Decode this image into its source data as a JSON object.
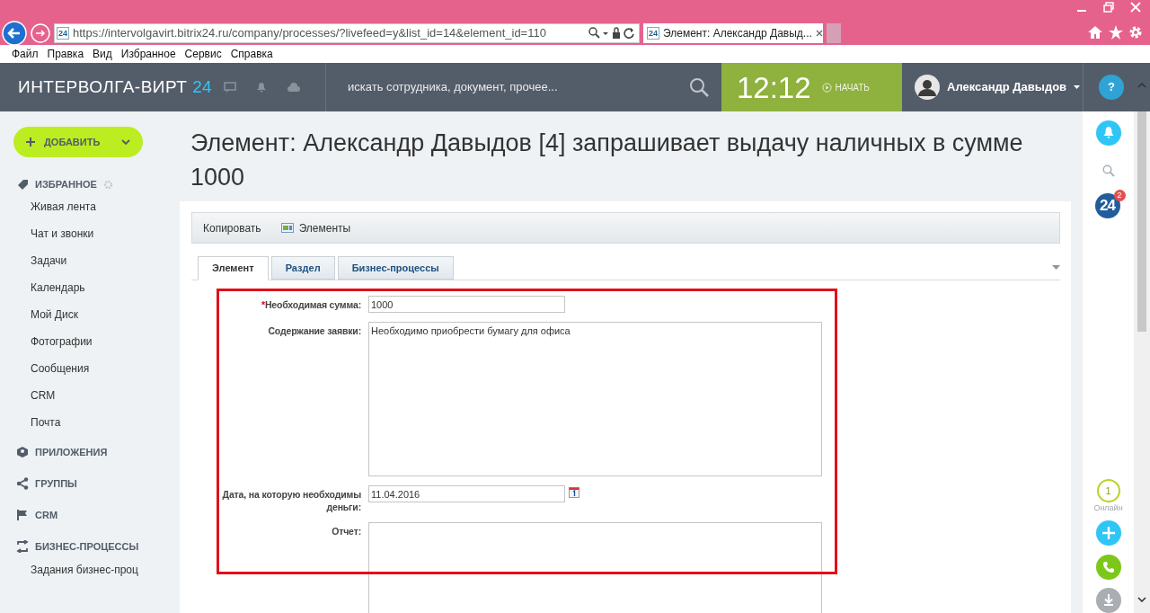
{
  "browser": {
    "url": "https://intervolgavirt.bitrix24.ru/company/processes/?livefeed=y&list_id=14&element_id=110",
    "favicon": "24",
    "tab": {
      "favicon": "24",
      "title": "Элемент: Александр Давыд..."
    },
    "menu": [
      "Файл",
      "Правка",
      "Вид",
      "Избранное",
      "Сервис",
      "Справка"
    ]
  },
  "header": {
    "logo": "ИНТЕРВОЛГА-ВИРТ",
    "logo_suffix": "24",
    "search_placeholder": "искать сотрудника, документ, прочее...",
    "clock": "12:12",
    "start": "НАЧАТЬ",
    "user": "Александр Давыдов",
    "help": "?"
  },
  "sidebar": {
    "add_button": "ДОБАВИТЬ",
    "sections": [
      {
        "kind": "favorites",
        "title": "ИЗБРАННОЕ",
        "items": [
          "Живая лента",
          "Чат и звонки",
          "Задачи",
          "Календарь",
          "Мой Диск",
          "Фотографии",
          "Сообщения",
          "CRM",
          "Почта"
        ]
      },
      {
        "kind": "apps",
        "title": "ПРИЛОЖЕНИЯ"
      },
      {
        "kind": "groups",
        "title": "ГРУППЫ"
      },
      {
        "kind": "crm",
        "title": "CRM"
      },
      {
        "kind": "processes",
        "title": "БИЗНЕС-ПРОЦЕССЫ",
        "items": [
          "Задания бизнес-проц"
        ]
      }
    ]
  },
  "page": {
    "title": "Элемент: Александр Давыдов [4] запрашивает выдачу наличных в сумме 1000",
    "toolbar": [
      {
        "kind": "text",
        "label": "Копировать"
      },
      {
        "kind": "icon",
        "label": "Элементы"
      }
    ],
    "tabs": [
      {
        "label": "Элемент",
        "selected": true
      },
      {
        "label": "Раздел",
        "selected": false
      },
      {
        "label": "Бизнес-процессы",
        "selected": false
      }
    ],
    "fields": [
      {
        "kind": "input",
        "label": "Необходимая сумма:",
        "required_mark": "*",
        "value": "1000"
      },
      {
        "kind": "textarea",
        "label": "Содержание заявки:",
        "value": "Необходимо приобрести бумагу для офиса"
      },
      {
        "kind": "date",
        "label": "Дата, на которую необходимы деньги:",
        "value": "11.04.2016"
      },
      {
        "kind": "textarea",
        "label": "Отчет:"
      }
    ]
  },
  "right_panel": {
    "logo": "24",
    "badge": "2",
    "online_count": "1",
    "online_label": "Онлайн"
  }
}
